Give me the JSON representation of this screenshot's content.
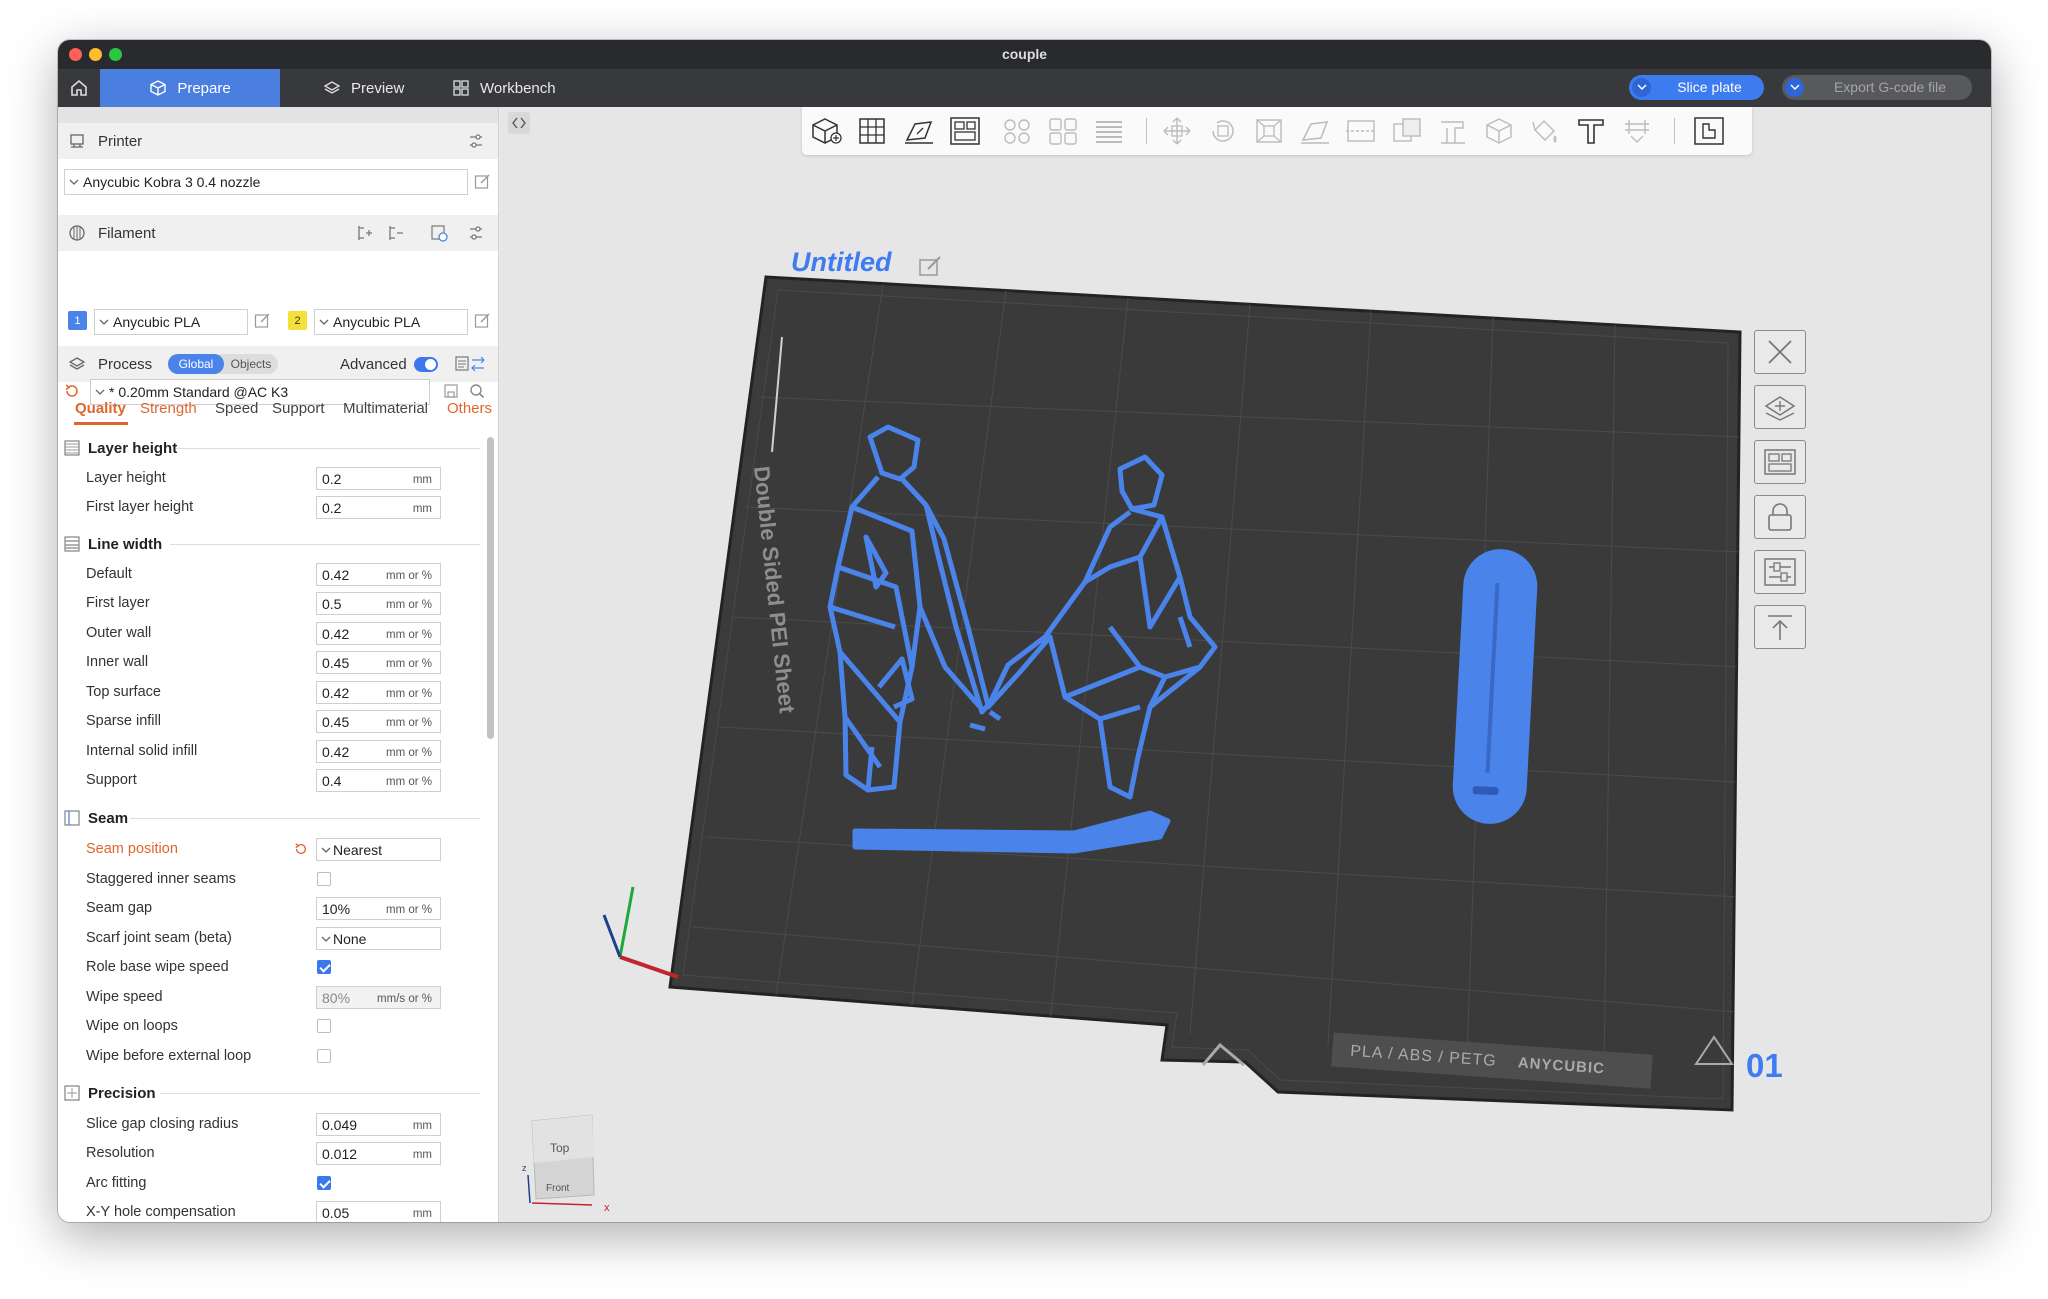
{
  "window": {
    "title": "couple"
  },
  "tabs": [
    {
      "label": "Prepare",
      "icon": "cube-icon",
      "active": true
    },
    {
      "label": "Preview",
      "icon": "layers-icon",
      "active": false
    },
    {
      "label": "Workbench",
      "icon": "grid-icon",
      "active": false
    }
  ],
  "actions": {
    "slice": "Slice plate",
    "export": "Export G-code file"
  },
  "printer": {
    "section_title": "Printer",
    "selected": "Anycubic Kobra 3 0.4 nozzle"
  },
  "filament": {
    "section_title": "Filament",
    "slots": [
      {
        "index": "1",
        "name": "Anycubic PLA",
        "color": "#4a84ea"
      },
      {
        "index": "2",
        "name": "Anycubic PLA",
        "color": "#f3e13a"
      }
    ]
  },
  "process": {
    "section_title": "Process",
    "mode_global": "Global",
    "mode_objects": "Objects",
    "advanced_label": "Advanced",
    "advanced_on": true,
    "preset": "* 0.20mm Standard @AC K3"
  },
  "subtabs": [
    "Quality",
    "Strength",
    "Speed",
    "Support",
    "Multimaterial",
    "Others"
  ],
  "groups": {
    "layer_height": {
      "title": "Layer height",
      "rows": [
        {
          "label": "Layer height",
          "value": "0.2",
          "unit": "mm"
        },
        {
          "label": "First layer height",
          "value": "0.2",
          "unit": "mm"
        }
      ]
    },
    "line_width": {
      "title": "Line width",
      "rows": [
        {
          "label": "Default",
          "value": "0.42",
          "unit": "mm or %"
        },
        {
          "label": "First layer",
          "value": "0.5",
          "unit": "mm or %"
        },
        {
          "label": "Outer wall",
          "value": "0.42",
          "unit": "mm or %"
        },
        {
          "label": "Inner wall",
          "value": "0.45",
          "unit": "mm or %"
        },
        {
          "label": "Top surface",
          "value": "0.42",
          "unit": "mm or %"
        },
        {
          "label": "Sparse infill",
          "value": "0.45",
          "unit": "mm or %"
        },
        {
          "label": "Internal solid infill",
          "value": "0.42",
          "unit": "mm or %"
        },
        {
          "label": "Support",
          "value": "0.4",
          "unit": "mm or %"
        }
      ]
    },
    "seam": {
      "title": "Seam",
      "rows": [
        {
          "label": "Seam position",
          "value": "Nearest"
        },
        {
          "label": "Staggered inner seams",
          "checked": false
        },
        {
          "label": "Seam gap",
          "value": "10%",
          "unit": "mm or %"
        },
        {
          "label": "Scarf joint seam (beta)",
          "value": "None"
        },
        {
          "label": "Role base wipe speed",
          "checked": true
        },
        {
          "label": "Wipe speed",
          "value": "80%",
          "unit": "mm/s or %"
        },
        {
          "label": "Wipe on loops",
          "checked": false
        },
        {
          "label": "Wipe before external loop",
          "checked": false
        }
      ]
    },
    "precision": {
      "title": "Precision",
      "rows": [
        {
          "label": "Slice gap closing radius",
          "value": "0.049",
          "unit": "mm"
        },
        {
          "label": "Resolution",
          "value": "0.012",
          "unit": "mm"
        },
        {
          "label": "Arc fitting",
          "checked": true
        },
        {
          "label": "X-Y hole compensation",
          "value": "0.05",
          "unit": "mm"
        }
      ]
    }
  },
  "plate": {
    "name": "Untitled",
    "index": "01",
    "sheet_text": "Double Sided PEI Sheet",
    "material_text": "PLA / ABS / PETG",
    "brand_text": "ANYCUBIC"
  },
  "view_cube": {
    "top": "Top",
    "front": "Front",
    "axis_x": "x",
    "axis_z": "z"
  },
  "colors": {
    "accent": "#3d7bf0",
    "warn": "#e0662e",
    "model": "#4a84ea",
    "bed": "#3a3a3a"
  }
}
